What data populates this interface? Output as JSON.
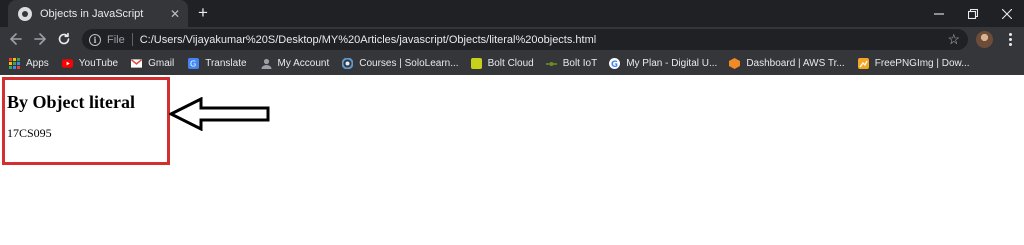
{
  "browser": {
    "tab": {
      "title": "Objects in JavaScript",
      "close_glyph": "✕"
    },
    "new_tab_glyph": "+",
    "address_bar": {
      "scheme": "File",
      "url": "C:/Users/Vijayakumar%20S/Desktop/MY%20Articles/javascript/Objects/literal%20objects.html"
    },
    "star_glyph": "☆",
    "bookmarks": [
      {
        "label": "Apps",
        "icon": "apps-grid-icon",
        "color": "#ea4335"
      },
      {
        "label": "YouTube",
        "icon": "youtube-icon",
        "color": "#ff0000"
      },
      {
        "label": "Gmail",
        "icon": "gmail-icon",
        "color": "#ea4335"
      },
      {
        "label": "Translate",
        "icon": "translate-icon",
        "color": "#4285f4"
      },
      {
        "label": "My Account",
        "icon": "google-account-icon",
        "color": "#9aa0a6"
      },
      {
        "label": "Courses | SoloLearn...",
        "icon": "sololearn-icon",
        "color": "#5b9bd5"
      },
      {
        "label": "Bolt Cloud",
        "icon": "bolt-cloud-icon",
        "color": "#c6d219"
      },
      {
        "label": "Bolt IoT",
        "icon": "bolt-iot-icon",
        "color": "#6b8e23"
      },
      {
        "label": "My Plan - Digital U...",
        "icon": "google-g-icon",
        "color": "#ffffff"
      },
      {
        "label": "Dashboard | AWS Tr...",
        "icon": "aws-icon",
        "color": "#f08a24"
      },
      {
        "label": "FreePNGImg | Dow...",
        "icon": "freepngimg-icon",
        "color": "#f5a623"
      }
    ]
  },
  "page": {
    "heading": "By Object literal",
    "text": "17CS095",
    "highlight_color": "#d32f2f"
  }
}
